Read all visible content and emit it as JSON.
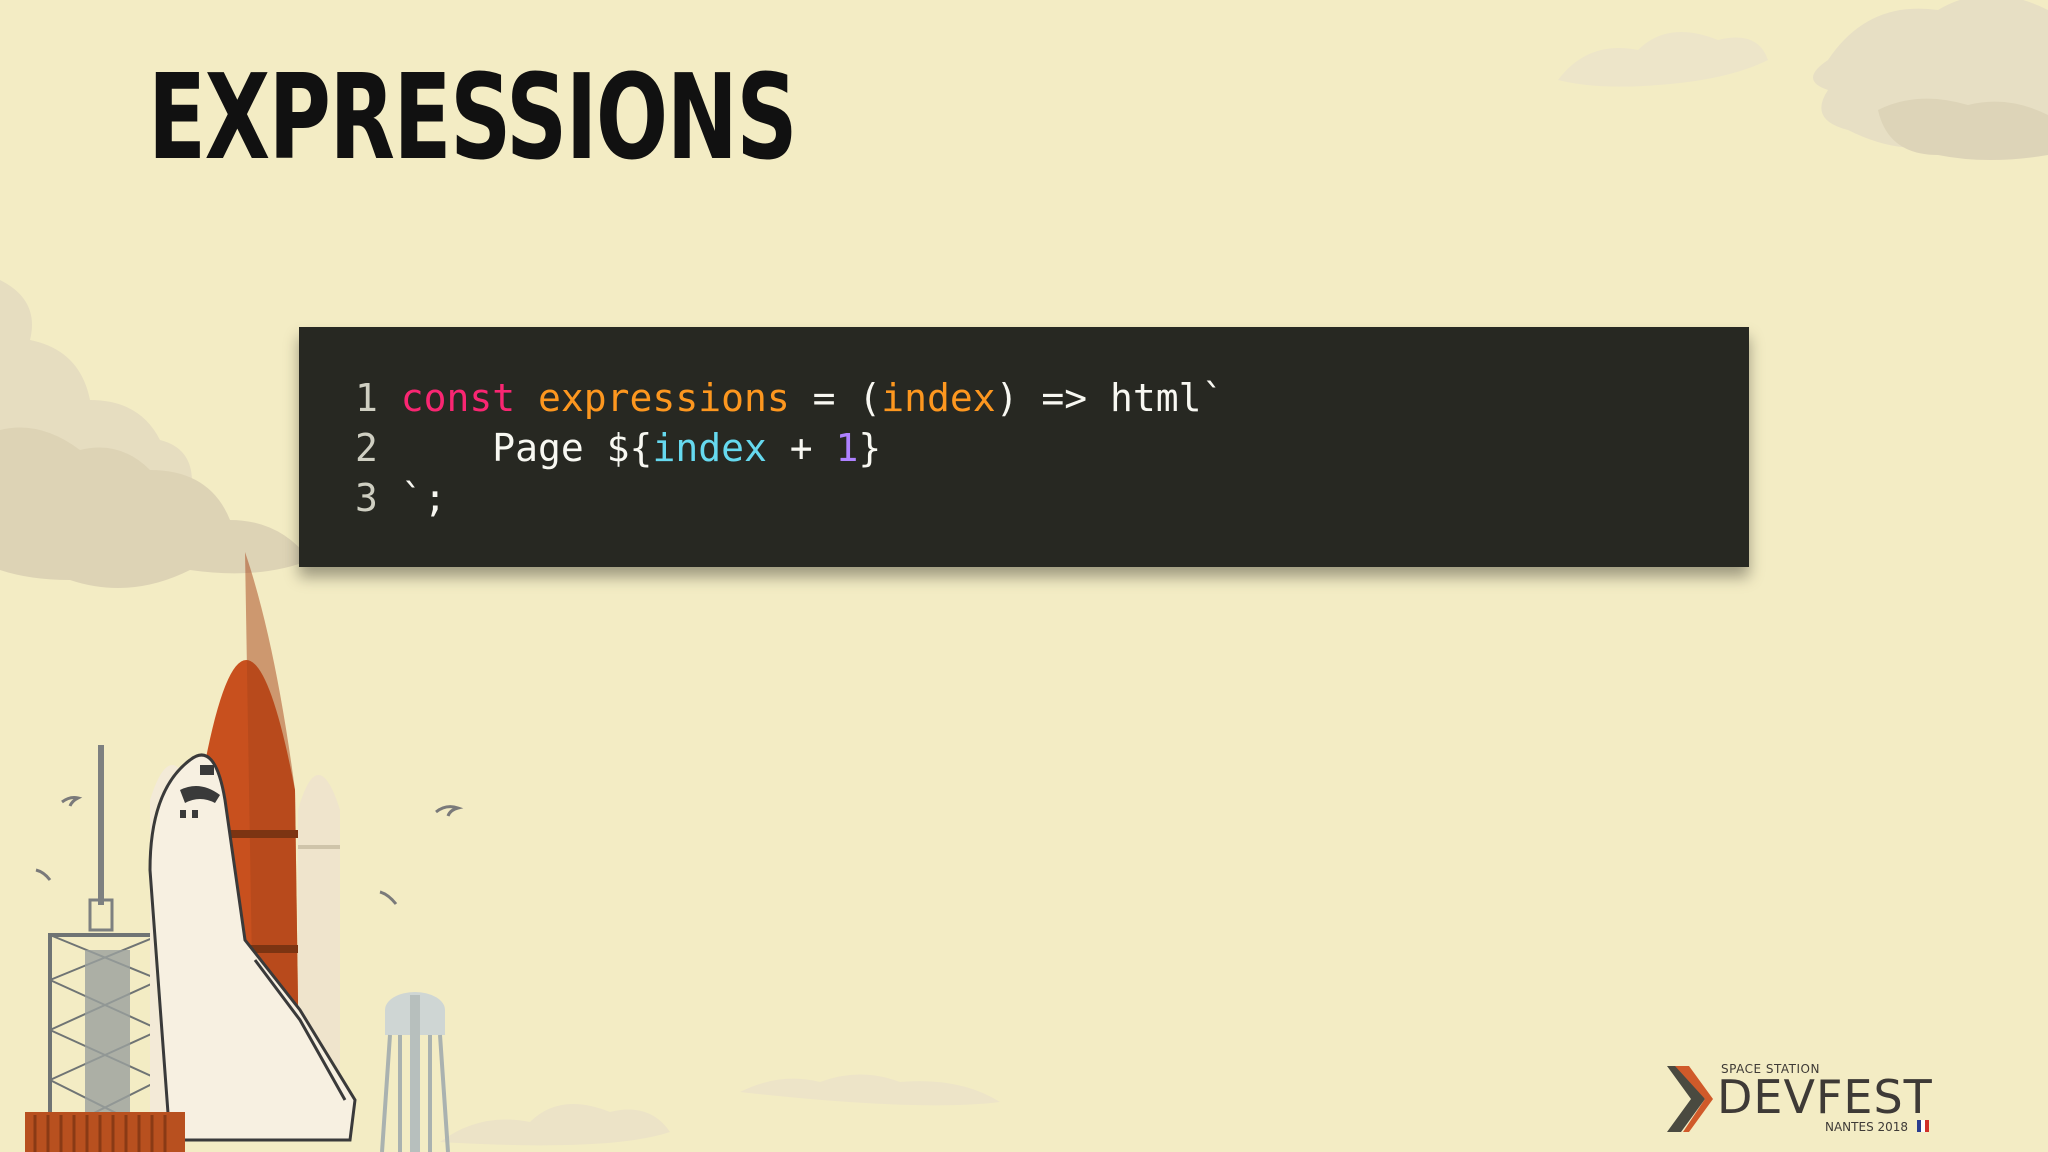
{
  "slide": {
    "title": "EXPRESSIONS"
  },
  "code": {
    "lines": [
      {
        "number": "1",
        "tokens": [
          {
            "text": "const",
            "kind": "kw"
          },
          {
            "text": " ",
            "kind": "plain"
          },
          {
            "text": "expressions",
            "kind": "fn"
          },
          {
            "text": " = (",
            "kind": "plain"
          },
          {
            "text": "index",
            "kind": "param"
          },
          {
            "text": ") => html`",
            "kind": "plain"
          }
        ]
      },
      {
        "number": "2",
        "tokens": [
          {
            "text": "    Page ${",
            "kind": "plain"
          },
          {
            "text": "index",
            "kind": "var"
          },
          {
            "text": " + ",
            "kind": "plain"
          },
          {
            "text": "1",
            "kind": "num"
          },
          {
            "text": "}",
            "kind": "plain"
          }
        ]
      },
      {
        "number": "3",
        "tokens": [
          {
            "text": "`;",
            "kind": "plain"
          }
        ]
      }
    ]
  },
  "logo": {
    "top_text": "SPACE STATION",
    "main_text": "DEVFEST",
    "sub_text": "NANTES 2018"
  },
  "colors": {
    "background": "#f3ecc4",
    "code_bg": "#272822",
    "keyword": "#f92672",
    "function": "#fd971f",
    "variable": "#66d9ef",
    "number": "#ae81ff",
    "rocket_orange": "#c8501e"
  },
  "icons": [
    "cloud-icon",
    "space-shuttle-icon",
    "launch-tower-icon",
    "water-tower-icon",
    "bird-icon",
    "devfest-chevron-icon",
    "french-flag-icon"
  ]
}
